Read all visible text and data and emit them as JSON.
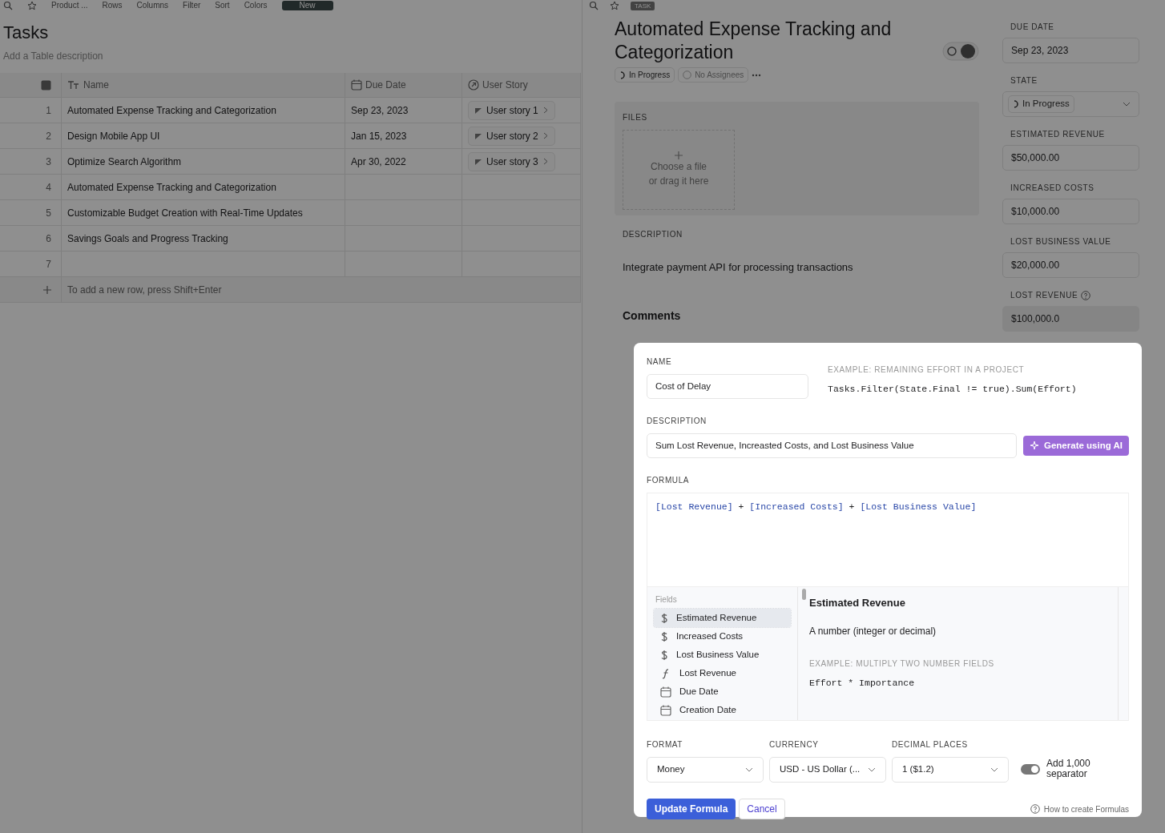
{
  "left_toolbar": {
    "breadcrumb": "Product ...",
    "buttons": [
      "Rows",
      "Columns",
      "Filter",
      "Sort",
      "Colors"
    ],
    "new_button": "New"
  },
  "table": {
    "title": "Tasks",
    "description_placeholder": "Add a Table description",
    "columns": [
      {
        "label": "Name",
        "kind": "text"
      },
      {
        "label": "Due Date",
        "kind": "date"
      },
      {
        "label": "User Story",
        "kind": "link"
      }
    ],
    "rows": [
      {
        "index": "1",
        "name": "Automated Expense Tracking and Categorization",
        "due_date": "Sep 23, 2023",
        "user_story": "User story 1"
      },
      {
        "index": "2",
        "name": "Design Mobile App UI",
        "due_date": "Jan 15, 2023",
        "user_story": "User story 2"
      },
      {
        "index": "3",
        "name": "Optimize Search Algorithm",
        "due_date": "Apr 30, 2022",
        "user_story": "User story 3"
      },
      {
        "index": "4",
        "name": "Automated Expense Tracking and Categorization"
      },
      {
        "index": "5",
        "name": "Customizable Budget Creation with Real-Time Updates"
      },
      {
        "index": "6",
        "name": "Savings Goals and Progress Tracking"
      },
      {
        "index": "7"
      }
    ],
    "add_row_hint": "To add a new row, press Shift+Enter"
  },
  "task": {
    "tag": "TASK",
    "title": "Automated Expense Tracking and Categorization",
    "status": "In Progress",
    "assignees": "No Assignees",
    "files_label": "FILES",
    "upload_lines": [
      "Choose a file",
      "or drag it here"
    ],
    "description_label": "DESCRIPTION",
    "description": "Integrate payment API for processing transactions",
    "comments_label": "Comments"
  },
  "properties": [
    {
      "label": "DUE DATE",
      "value": "Sep 23, 2023",
      "kind": "text"
    },
    {
      "label": "STATE",
      "value": "In Progress",
      "kind": "select"
    },
    {
      "label": "ESTIMATED REVENUE",
      "value": "$50,000.00",
      "kind": "text"
    },
    {
      "label": "INCREASED COSTS",
      "value": "$10,000.00",
      "kind": "text"
    },
    {
      "label": "LOST BUSINESS VALUE",
      "value": "$20,000.00",
      "kind": "text"
    },
    {
      "label": "LOST REVENUE",
      "value": "$100,000.0",
      "kind": "formula"
    }
  ],
  "formula_dialog": {
    "name_label": "NAME",
    "name_value": "Cost of Delay",
    "example_label": "EXAMPLE: REMAINING EFFORT IN A PROJECT",
    "example_code": "Tasks.Filter(State.Final != true).Sum(Effort)",
    "description_label": "DESCRIPTION",
    "description_value": "Sum Lost Revenue, Increasted Costs, and Lost Business Value",
    "generate_button": "Generate using AI",
    "formula_label": "FORMULA",
    "formula": "[Lost Revenue] + [Increased Costs] + [Lost Business Value]",
    "fields_heading": "Fields",
    "fields": [
      {
        "label": "Estimated Revenue",
        "kind": "money",
        "selected": true
      },
      {
        "label": "Increased Costs",
        "kind": "money",
        "selected": false
      },
      {
        "label": "Lost Business Value",
        "kind": "money",
        "selected": false
      },
      {
        "label": "Lost Revenue",
        "kind": "formula",
        "selected": false
      },
      {
        "label": "Due Date",
        "kind": "date",
        "selected": false
      },
      {
        "label": "Creation Date",
        "kind": "date",
        "selected": false
      }
    ],
    "detail": {
      "title": "Estimated Revenue",
      "type": "A number (integer or decimal)",
      "example_label": "EXAMPLE: MULTIPLY TWO NUMBER FIELDS",
      "example_code": "Effort * Importance"
    },
    "selects": [
      {
        "label": "FORMAT",
        "value": "Money"
      },
      {
        "label": "CURRENCY",
        "value": "USD - US Dollar (..."
      },
      {
        "label": "DECIMAL PLACES",
        "value": "1 ($1.2)"
      }
    ],
    "separator_toggle": {
      "label": "Add 1,000 separator",
      "on": true
    },
    "update_button": "Update Formula",
    "cancel_button": "Cancel",
    "help_link": "How to create Formulas"
  }
}
